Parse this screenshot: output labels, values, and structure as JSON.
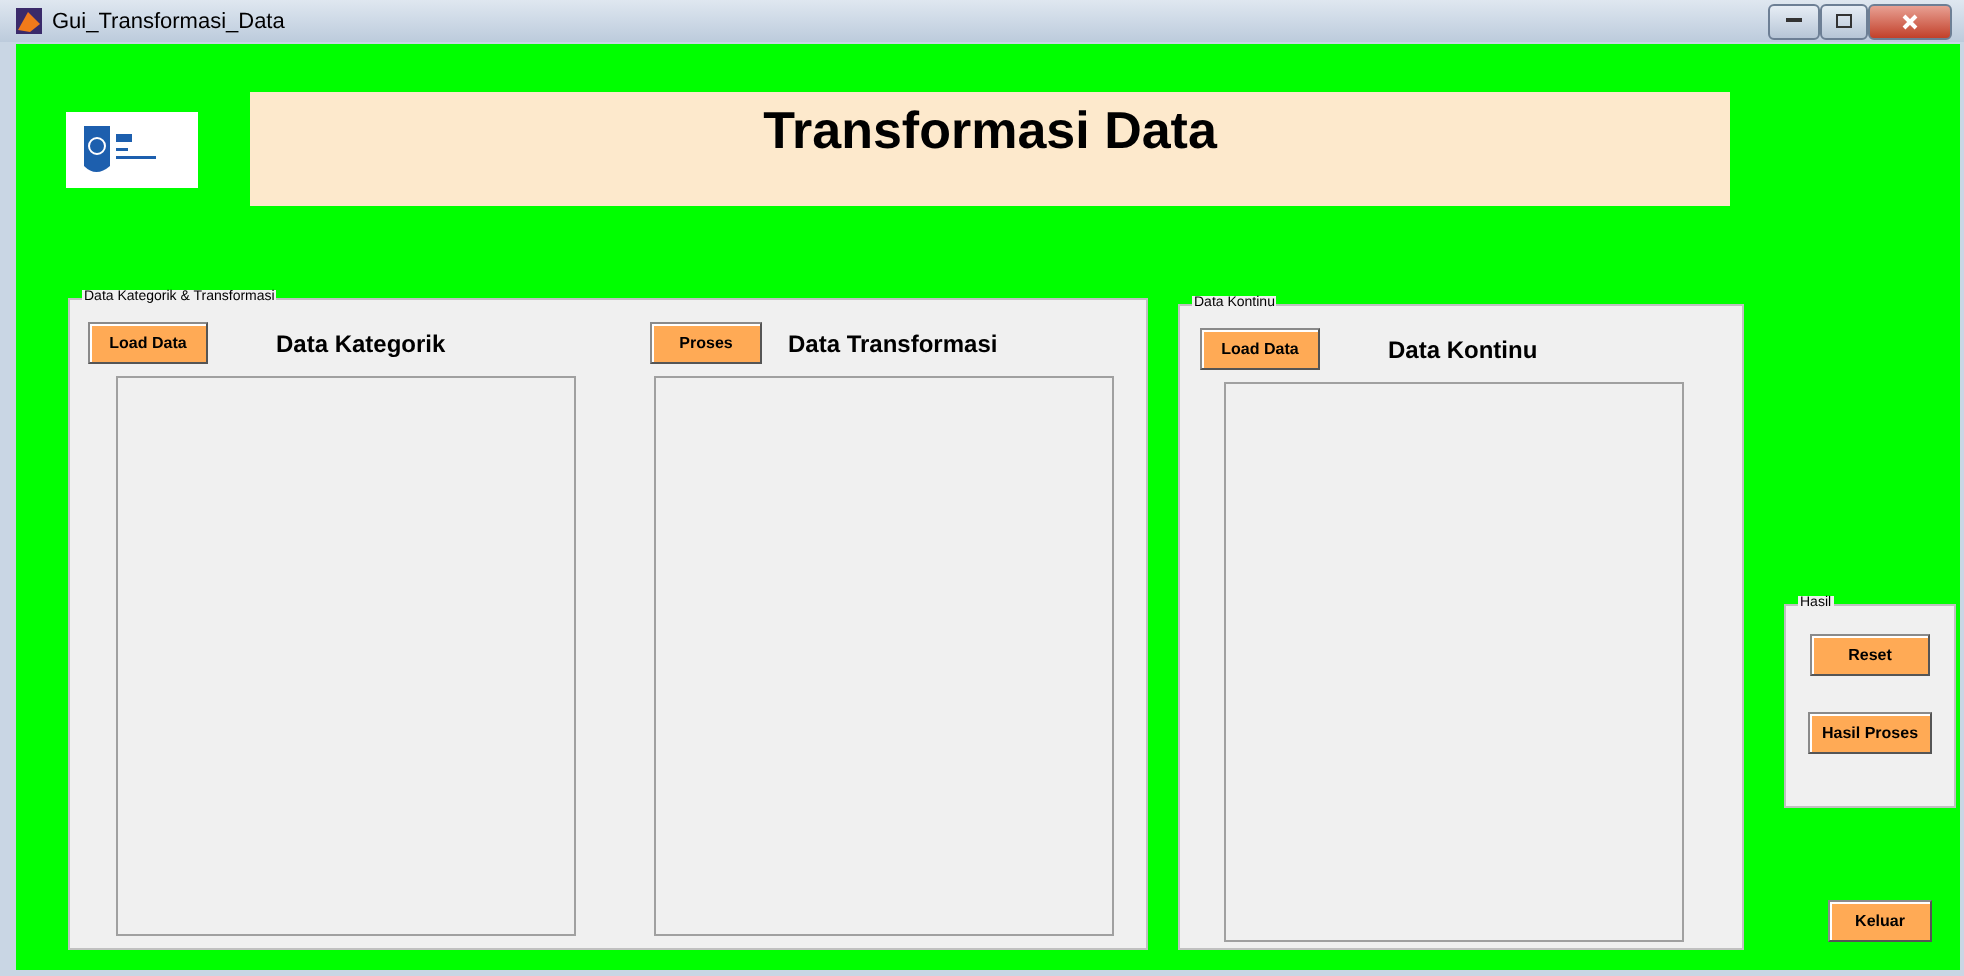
{
  "window": {
    "title": "Gui_Transformasi_Data"
  },
  "header": {
    "title": "Transformasi Data"
  },
  "panels": [
    {
      "title": "Data Kategorik & Transformasi",
      "sections": [
        {
          "button": "Load Data",
          "label": "Data Kategorik"
        },
        {
          "button": "Proses",
          "label": "Data Transformasi"
        }
      ]
    },
    {
      "title": "Data Kontinu",
      "sections": [
        {
          "button": "Load Data",
          "label": "Data Kontinu"
        }
      ]
    }
  ],
  "results": {
    "title": "Hasil",
    "buttons": [
      "Reset",
      "Hasil Proses"
    ]
  },
  "exit_button": "Keluar"
}
